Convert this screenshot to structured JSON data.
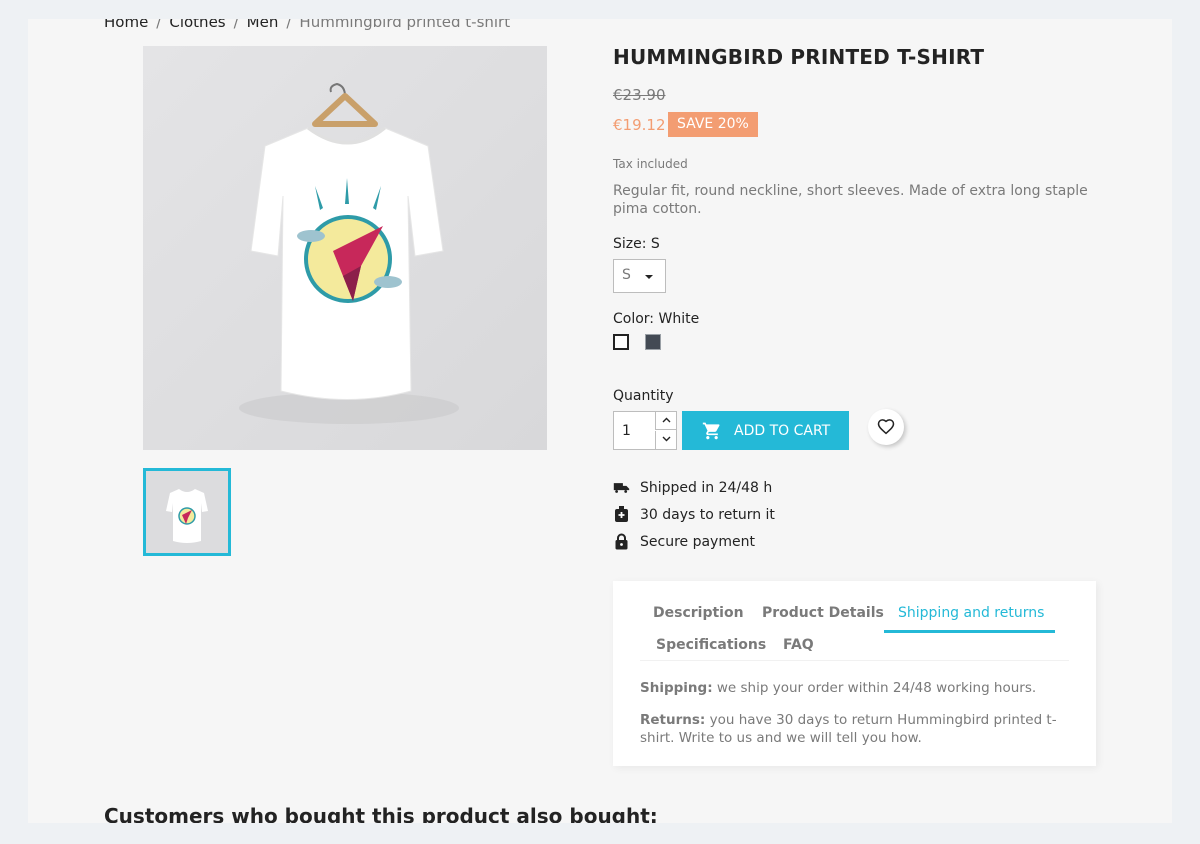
{
  "breadcrumb": {
    "items": [
      "Home",
      "Clothes",
      "Men"
    ],
    "current": "Hummingbird printed t-shirt",
    "separator": "/"
  },
  "product": {
    "title": "HUMMINGBIRD PRINTED T-SHIRT",
    "old_price": "€23.90",
    "price": "€19.12",
    "discount": "SAVE 20%",
    "tax_note": "Tax included",
    "description": "Regular fit, round neckline, short sleeves. Made of extra long staple pima cotton.",
    "size_label": "Size: S",
    "size_value": "S",
    "color_label": "Color: White",
    "colors": [
      "#ffffff",
      "#434a54"
    ],
    "quantity_label": "Quantity",
    "quantity_value": "1",
    "add_to_cart": "ADD TO CART"
  },
  "reassurance": [
    {
      "icon": "truck-icon",
      "text": "Shipped in 24/48 h"
    },
    {
      "icon": "return-box-icon",
      "text": "30 days to return it"
    },
    {
      "icon": "lock-icon",
      "text": "Secure payment"
    }
  ],
  "tabs": {
    "items": [
      "Description",
      "Product Details",
      "Shipping and returns",
      "Specifications",
      "FAQ"
    ],
    "active": "Shipping and returns",
    "content": {
      "shipping_label": "Shipping:",
      "shipping_text": " we ship your order within 24/48 working hours.",
      "returns_label": "Returns:",
      "returns_text": " you have 30 days to return Hummingbird printed t-shirt. Write to us and we will tell you how."
    }
  },
  "section_title": "Customers who bought this product also bought:",
  "colors": {
    "accent": "#24b9d7",
    "sale": "#f39d72",
    "muted": "#7a7a7a",
    "text": "#232323"
  }
}
